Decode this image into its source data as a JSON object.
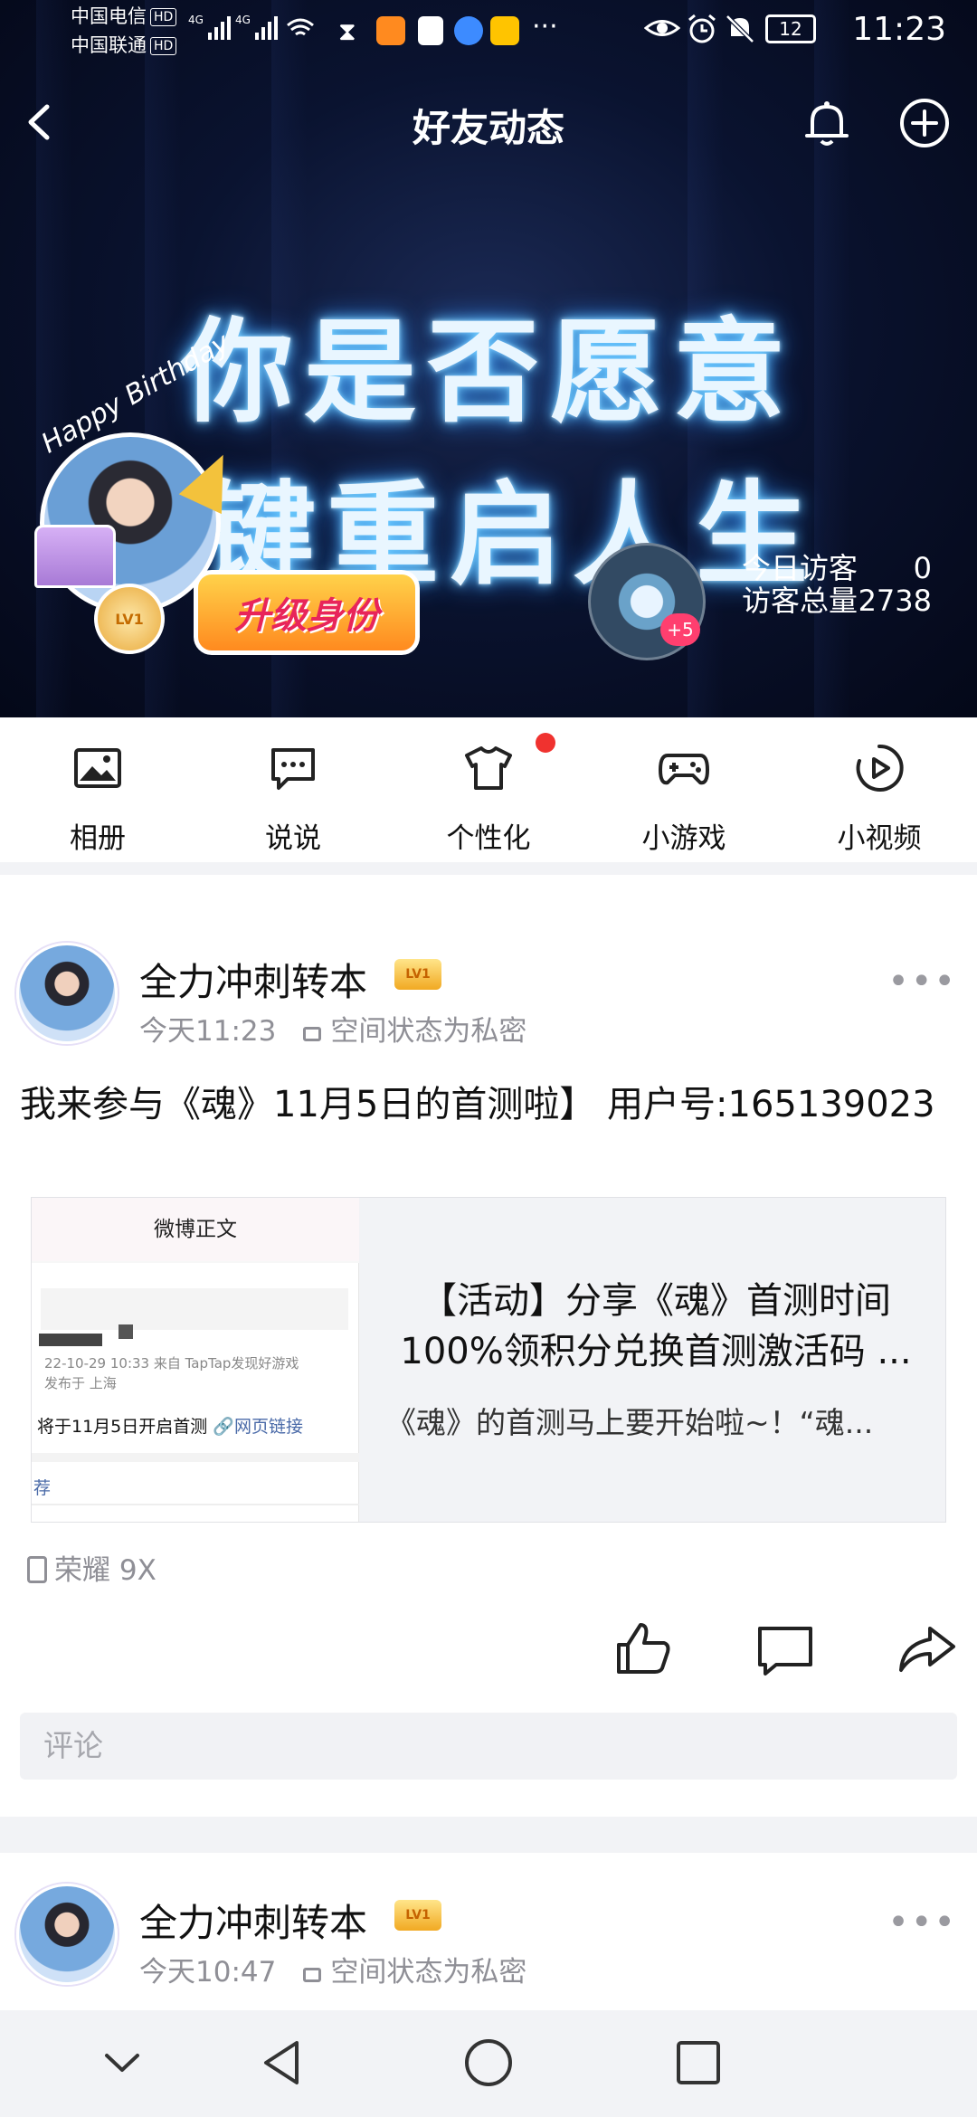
{
  "status_bar": {
    "carrier1": "中国电信",
    "carrier2": "中国联通",
    "hd": "HD",
    "net": "4G",
    "battery": "12",
    "time": "11:23",
    "dots": "···"
  },
  "header": {
    "title": "好友动态",
    "slogan_line1": "你是否愿意",
    "slogan_line2": "键重启人生",
    "birthday_text": "Happy Birthday",
    "level_badge": "LV1",
    "upgrade_label": "升级身份",
    "plus_count": "+5",
    "visitors_today_label": "今日访客",
    "visitors_today_value": "0",
    "visitors_total_label": "访客总量",
    "visitors_total_value": "2738"
  },
  "shortcuts": [
    {
      "label": "相册",
      "icon": "photo-album-icon"
    },
    {
      "label": "说说",
      "icon": "chat-bubble-icon"
    },
    {
      "label": "个性化",
      "icon": "tshirt-icon"
    },
    {
      "label": "小游戏",
      "icon": "gamepad-icon"
    },
    {
      "label": "小视频",
      "icon": "play-circle-icon"
    }
  ],
  "posts": [
    {
      "author": "全力冲刺转本",
      "vip": "LV1",
      "time": "今天11:23",
      "privacy": "空间状态为私密",
      "text": "我来参与《魂》11月5日的首测啦】 用户号:165139023",
      "card": {
        "thumb_header": "微博正文",
        "thumb_meta": "22-10-29 10:33  来自 TapTap发现好游戏",
        "thumb_loc": "发布于 上海",
        "thumb_text": "将于11月5日开启首测",
        "thumb_link": "🔗网页链接",
        "thumb_recommend": "荐",
        "title": "【活动】分享《魂》首测时间100%领积分兑换首测激活码 ...",
        "subtitle": "《魂》的首测马上要开始啦~！“魂..."
      },
      "device": "荣耀 9X",
      "comment_placeholder": "评论"
    },
    {
      "author": "全力冲刺转本",
      "vip": "LV1",
      "time": "今天10:47",
      "privacy": "空间状态为私密"
    }
  ],
  "colors": {
    "banner_bg": "#0a1330",
    "accent_red": "#f0322f",
    "gray_text": "#8f8f96"
  }
}
